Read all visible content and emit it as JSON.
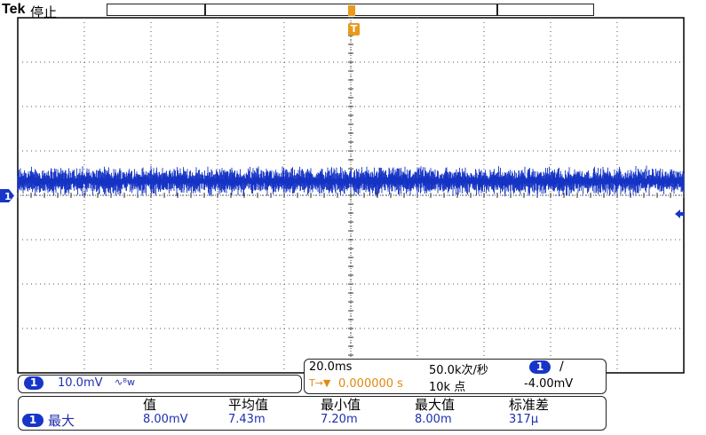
{
  "header": {
    "brand": "Tek",
    "status": "停止"
  },
  "colors": {
    "trace": "#1433c4",
    "trigger": "#e79a1c",
    "grid": "#000000"
  },
  "markers": {
    "trigger_position": "T",
    "channel": "1"
  },
  "icons": {
    "channel_marker": "ch1-ground-arrow-icon",
    "trigger_level": "trigger-level-arrow-icon",
    "coupling": "bandwidth-limit-icon",
    "trigger_slope": "rising-edge-icon",
    "trigger_delay": "trigger-delay-icon"
  },
  "channel_panel": {
    "channel": "1",
    "scale": "10.0mV",
    "bw_symbol": "∿ᴮ𝗐"
  },
  "timebase_panel": {
    "time_per_div": "20.0ms",
    "sample_rate": "50.0k次/秒",
    "delay_prefix": "T→▼",
    "delay": "0.000000 s",
    "record_length": "10k 点",
    "trigger_channel": "1",
    "trigger_slope_symbol": "/",
    "trigger_level": "-4.00mV"
  },
  "measurements": {
    "headers": [
      "值",
      "平均值",
      "最小值",
      "最大值",
      "标准差"
    ],
    "row": {
      "channel": "1",
      "label": "最大",
      "values": [
        "8.00mV",
        "7.43m",
        "7.20m",
        "8.00m",
        "317μ"
      ]
    }
  }
}
